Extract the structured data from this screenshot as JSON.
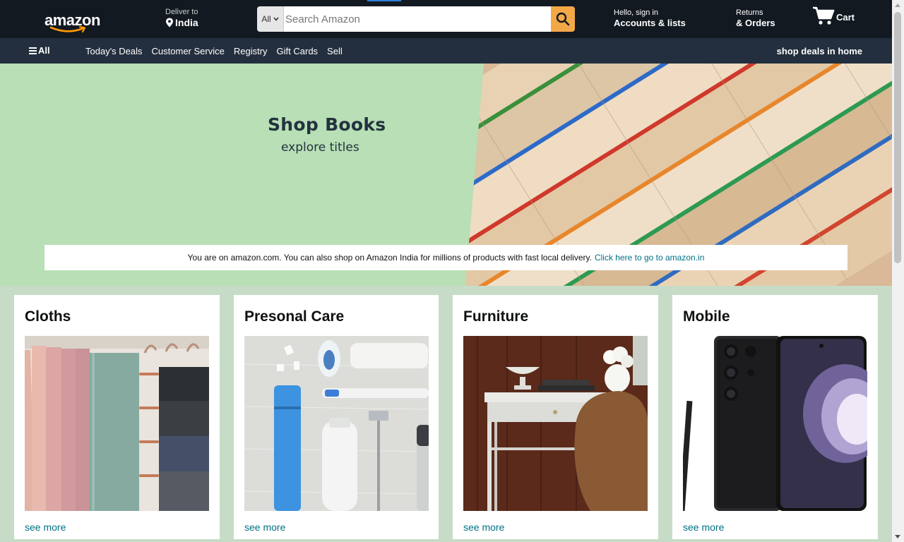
{
  "header": {
    "logo_text": "amazon",
    "deliver_label": "Deliver to",
    "deliver_location": "India",
    "search": {
      "category": "All",
      "placeholder": "Search Amazon",
      "value": ""
    },
    "account_greeting": "Hello, sign in",
    "account_label": "Accounts & lists",
    "returns_l1": "Returns",
    "returns_l2": "& Orders",
    "cart_label": "Cart"
  },
  "subnav": {
    "all_label": "All",
    "links": [
      "Today's Deals",
      "Customer Service",
      "Registry",
      "Gift Cards",
      "Sell"
    ],
    "promo": "shop deals in home"
  },
  "hero": {
    "title": "Shop Books",
    "subtitle": "explore titles",
    "notice_text": "You are on amazon.com. You can also shop on Amazon India for millions of products with fast local delivery.",
    "notice_link": "Click here to go to amazon.in"
  },
  "cards": [
    {
      "title": "Cloths",
      "link": "see more"
    },
    {
      "title": "Presonal Care",
      "link": "see more"
    },
    {
      "title": "Furniture",
      "link": "see more"
    },
    {
      "title": "Mobile",
      "link": "see more"
    }
  ],
  "colors": {
    "header_bg": "#131921",
    "subnav_bg": "#232f3e",
    "search_button": "#f3a847",
    "hero_bg": "#b8dfb5",
    "page_bg": "#c7dcc7",
    "link": "#007185"
  }
}
